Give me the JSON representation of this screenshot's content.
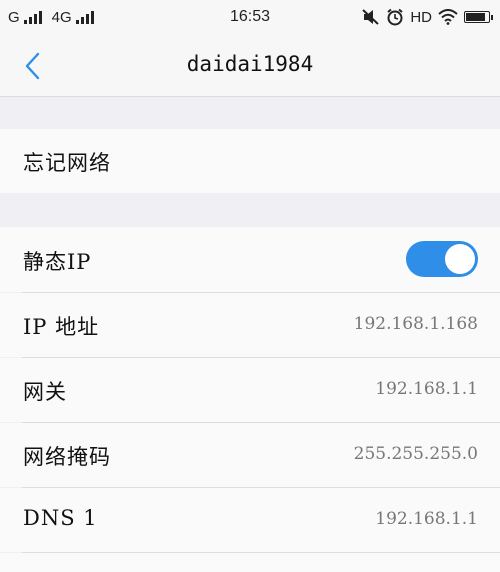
{
  "status_bar": {
    "carrier_1": "G",
    "carrier_2": "4G",
    "time": "16:53",
    "hd_label": "HD"
  },
  "nav": {
    "title": "daidai1984"
  },
  "forget_network": {
    "label": "忘记网络"
  },
  "settings": {
    "static_ip": {
      "label": "静态IP",
      "enabled": true
    },
    "ip_address": {
      "label": "IP 地址",
      "value": "192.168.1.168"
    },
    "gateway": {
      "label": "网关",
      "value": "192.168.1.1"
    },
    "netmask": {
      "label": "网络掩码",
      "value": "255.255.255.0"
    },
    "dns1": {
      "label": "DNS 1",
      "value": "192.168.1.1"
    }
  },
  "colors": {
    "accent": "#2f8ee8",
    "background": "#efeff4",
    "row": "#fafafa"
  }
}
